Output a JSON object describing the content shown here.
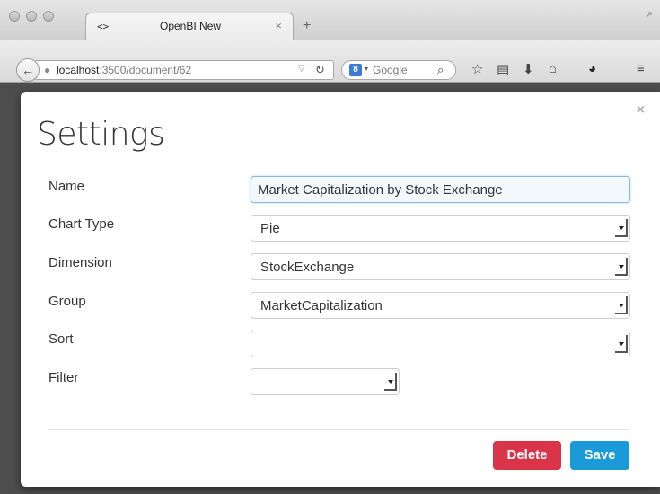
{
  "browser": {
    "tab": {
      "favicon": "<>",
      "title": "OpenBI New",
      "close": "×"
    },
    "new_tab": "+",
    "url": {
      "host": "localhost",
      "rest": ":3500/document/62"
    },
    "search": {
      "engine_letter": "8",
      "placeholder": "Google"
    },
    "icons": [
      "back-arrow-icon",
      "globe-icon",
      "reload-icon",
      "search-icon",
      "star-icon",
      "bookmarks-icon",
      "download-icon",
      "home-icon",
      "extension-icon",
      "menu-icon"
    ]
  },
  "modal": {
    "title": "Settings",
    "close": "×",
    "fields": {
      "name": {
        "label": "Name",
        "value": "Market Capitalization by Stock Exchange"
      },
      "chart_type": {
        "label": "Chart Type",
        "value": "Pie"
      },
      "dimension": {
        "label": "Dimension",
        "value": "StockExchange"
      },
      "group": {
        "label": "Group",
        "value": "MarketCapitalization"
      },
      "sort": {
        "label": "Sort",
        "value": ""
      },
      "filter": {
        "label": "Filter",
        "value": ""
      }
    },
    "buttons": {
      "delete": "Delete",
      "save": "Save"
    }
  },
  "colors": {
    "delete": "#d9344a",
    "save": "#1b9ad9"
  }
}
